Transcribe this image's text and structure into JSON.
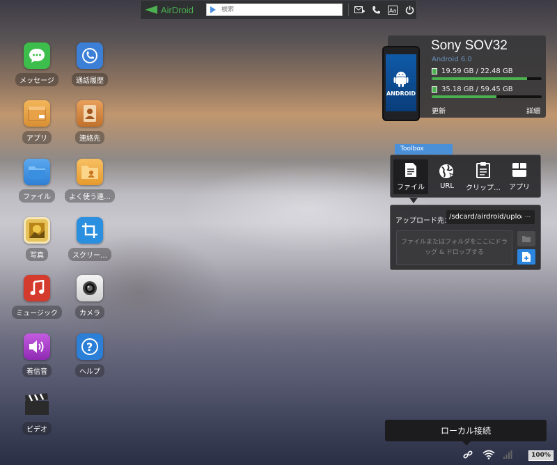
{
  "topbar": {
    "logo_text": "AirDroid",
    "search_placeholder": "検索",
    "icons": [
      "message-add-icon",
      "phone-icon",
      "translate-icon",
      "power-icon"
    ]
  },
  "apps": [
    {
      "label": "メッセージ",
      "icon": "message-icon",
      "color": "#3dbd4b"
    },
    {
      "label": "通話履歴",
      "icon": "call-log-icon",
      "color": "#3c7fd6"
    },
    {
      "label": "アプリ",
      "icon": "app-box-icon",
      "color": "#e8a24a"
    },
    {
      "label": "連絡先",
      "icon": "contacts-icon",
      "color": "#c77b2b"
    },
    {
      "label": "ファイル",
      "icon": "folder-icon",
      "color": "#3d8fe0"
    },
    {
      "label": "よく使う連…",
      "icon": "favorite-contacts-icon",
      "color": "#f0a93c"
    },
    {
      "label": "写真",
      "icon": "photo-icon",
      "color": "#d9a92c"
    },
    {
      "label": "スクリー…",
      "icon": "screenshot-icon",
      "color": "#2b8fe0"
    },
    {
      "label": "ミュージック",
      "icon": "music-icon",
      "color": "#d53b2c"
    },
    {
      "label": "カメラ",
      "icon": "camera-icon",
      "color": "#e2e2e2"
    },
    {
      "label": "着信音",
      "icon": "ringtone-icon",
      "color": "#a43fc4"
    },
    {
      "label": "ヘルプ",
      "icon": "help-icon",
      "color": "#2b7fd6"
    },
    {
      "label": "ビデオ",
      "icon": "video-icon",
      "color": "#333333"
    }
  ],
  "device": {
    "name": "Sony SOV32",
    "android_version": "Android 6.0",
    "screen_text": "ANDROID",
    "storage": [
      {
        "text": "19.59 GB / 22.48 GB",
        "used_fraction": 0.87
      },
      {
        "text": "35.18 GB / 59.45 GB",
        "used_fraction": 0.59
      }
    ],
    "refresh_label": "更新",
    "details_label": "詳細"
  },
  "toolbox": {
    "tab_label": "Toolbox",
    "tools": [
      {
        "label": "ファイル",
        "icon": "file-icon"
      },
      {
        "label": "URL",
        "icon": "globe-icon"
      },
      {
        "label": "クリップ…",
        "icon": "clipboard-icon"
      },
      {
        "label": "アプリ",
        "icon": "app-icon"
      }
    ],
    "upload_label": "アップロード先：",
    "upload_path": "/sdcard/airdroid/upload",
    "more_label": "···",
    "drop_text": "ファイルまたはフォルダをここにドラッグ & ドロップする"
  },
  "status": {
    "tooltip": "ローカル接続",
    "battery": "100%",
    "accent": "#2b85df"
  }
}
